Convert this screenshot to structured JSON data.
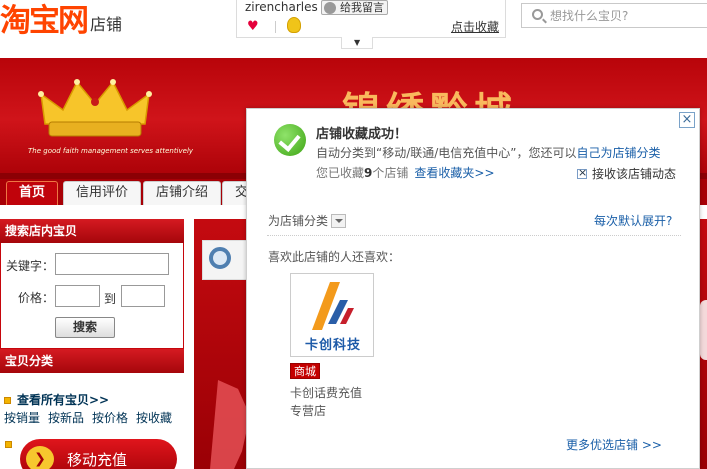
{
  "header": {
    "logo_main": "淘宝网",
    "logo_sub": "店铺",
    "username": "zirencharles",
    "message_button": "给我留言",
    "favorite_link": "点击收藏",
    "search_placeholder": "想找什么宝贝?"
  },
  "banner": {
    "shop_title": "锦绣黔城",
    "slogan": "The good faith management serves attentively"
  },
  "nav": {
    "tabs": [
      "首页",
      "信用评价",
      "店铺介绍",
      "交"
    ]
  },
  "sidebar": {
    "search_title": "搜索店内宝贝",
    "keyword_label": "关键字：",
    "price_label": "价格：",
    "to_label": "到",
    "search_button": "搜索",
    "category_title": "宝贝分类",
    "all_items": "查看所有宝贝>>",
    "sorts": [
      "按销量",
      "按新品",
      "按价格",
      "按收藏"
    ],
    "mobile_recharge": "移动充值"
  },
  "popup": {
    "close": "×",
    "success_title": "店铺收藏成功！",
    "desc_prefix": "自动分类到“移动/联通/电信充值中心”，您还可以",
    "desc_link": "自己为店铺分类",
    "count_prefix": "您已收藏",
    "count_value": "9",
    "count_suffix": "个店铺",
    "view_favorites": "查看收藏夹>>",
    "receive_updates": "接收该店铺动态",
    "category_select": "为店铺分类",
    "expand_default": "每次默认展开?",
    "also_like": "喜欢此店铺的人还喜欢：",
    "shop": {
      "logo_text": "卡创科技",
      "badge": "商城",
      "name": "卡创话费充值",
      "type": "专营店"
    },
    "more_shops": "更多优选店铺 >>"
  }
}
